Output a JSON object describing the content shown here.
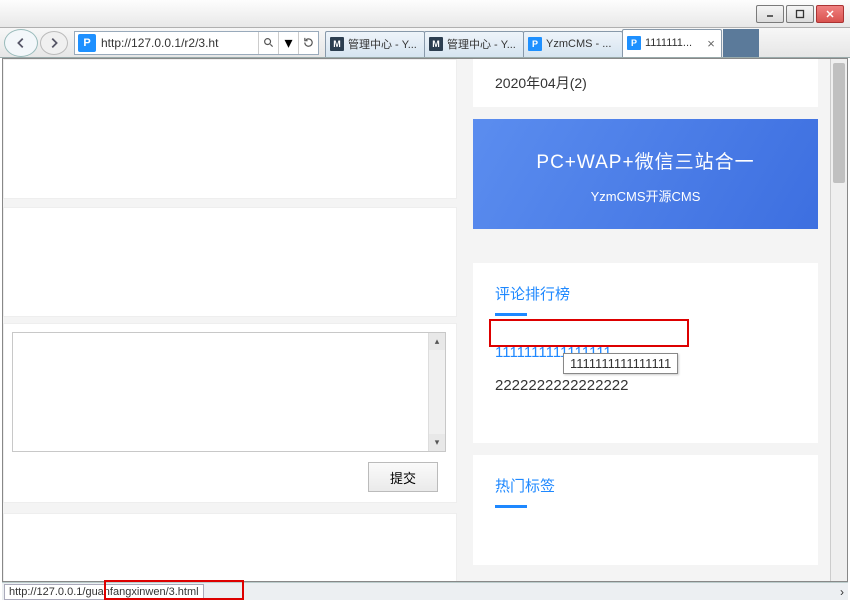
{
  "window": {
    "min_label": "minimize",
    "max_label": "maximize",
    "close_label": "close"
  },
  "address": {
    "url": "http://127.0.0.1/r2/3.ht",
    "search_hint": "P"
  },
  "tabs": [
    {
      "icon": "M",
      "label": "管理中心 - Y...",
      "active": false
    },
    {
      "icon": "M",
      "label": "管理中心 - Y...",
      "active": false
    },
    {
      "icon": "P",
      "label": "YzmCMS - ...",
      "active": false
    },
    {
      "icon": "P",
      "label": "1111111...",
      "active": true
    }
  ],
  "sidebar": {
    "date_archive": "2020年04月(2)",
    "banner_title": "PC+WAP+微信三站合一",
    "banner_sub": "YzmCMS开源CMS",
    "rank_title": "评论排行榜",
    "rank_items": [
      "1111111111111111",
      "2222222222222222"
    ],
    "tooltip": "1111111111111111",
    "tags_title": "热门标签"
  },
  "form": {
    "submit_label": "提交"
  },
  "status": {
    "hover_url": "http://127.0.0.1/guanfangxinwen/3.html"
  }
}
